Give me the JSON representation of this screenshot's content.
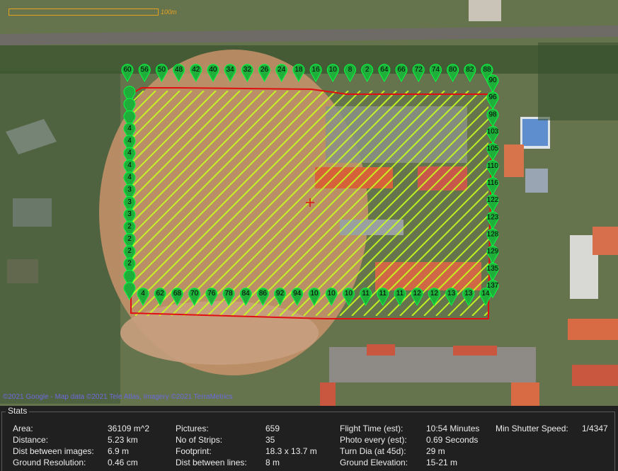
{
  "map": {
    "scale_label": "100m",
    "attribution": "©2021 Google - Map data ©2021 Tele Atlas, Imagery ©2021 TerraMetrics",
    "colors": {
      "polygon": "#e01010",
      "marker": "#1fae3a",
      "grid_lines": "#c8ff1e",
      "marker_halo": "#00ff40"
    },
    "waypoints": {
      "top": [
        "60",
        "56",
        "50",
        "48",
        "42",
        "40",
        "34",
        "32",
        "26",
        "24",
        "18",
        "16",
        "10",
        "8",
        "2",
        "64",
        "66",
        "72",
        "74",
        "80",
        "82",
        "88"
      ],
      "bottom": [
        "4",
        "62",
        "68",
        "70",
        "76",
        "78",
        "84",
        "86",
        "92",
        "94",
        "10",
        "10",
        "10",
        "11",
        "11",
        "11",
        "12",
        "12",
        "13",
        "13",
        "14"
      ],
      "left": [
        "",
        "",
        "",
        "4",
        "4",
        "4",
        "4",
        "4",
        "3",
        "3",
        "3",
        "2",
        "2",
        "2",
        "2",
        "",
        ""
      ],
      "right": [
        "90",
        "96",
        "98",
        "103",
        "105",
        "110",
        "116",
        "122",
        "123",
        "128",
        "129",
        "135",
        "137"
      ]
    }
  },
  "stats": {
    "title": "Stats",
    "rows": [
      {
        "label": "Area:",
        "value": "36109 m^2"
      },
      {
        "label": "Distance:",
        "value": "5.23 km"
      },
      {
        "label": "Dist between images:",
        "value": "6.9 m"
      },
      {
        "label": "Ground Resolution:",
        "value": "0.46 cm"
      },
      {
        "label": "Pictures:",
        "value": "659"
      },
      {
        "label": "No of Strips:",
        "value": "35"
      },
      {
        "label": "Footprint:",
        "value": "18.3 x 13.7 m"
      },
      {
        "label": "Dist between lines:",
        "value": "8 m"
      },
      {
        "label": "Flight Time (est):",
        "value": "10:54 Minutes"
      },
      {
        "label": "Photo every (est):",
        "value": "0.69 Seconds"
      },
      {
        "label": "Turn Dia (at 45d):",
        "value": "29 m"
      },
      {
        "label": "Ground Elevation:",
        "value": "15-21 m"
      },
      {
        "label": "Min Shutter Speed:",
        "value": "1/4347"
      }
    ]
  }
}
